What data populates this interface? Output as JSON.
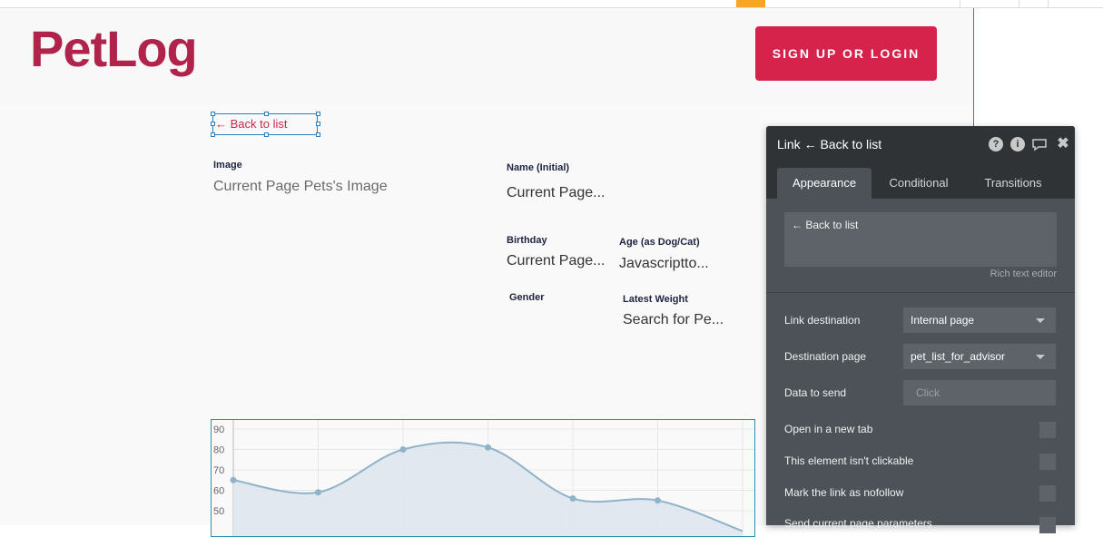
{
  "header": {
    "logo": "PetLog",
    "signup_label": "SIGN UP OR LOGIN"
  },
  "back_link": {
    "label": "← Back to list"
  },
  "fields": {
    "image": {
      "label": "Image",
      "value": "Current Page Pets's Image"
    },
    "name": {
      "label": "Name (Initial)",
      "value": "Current Page..."
    },
    "birthday": {
      "label": "Birthday",
      "value": "Current Page..."
    },
    "age": {
      "label": "Age (as Dog/Cat)",
      "value": "Javascriptto..."
    },
    "gender": {
      "label": "Gender",
      "value": ""
    },
    "weight": {
      "label": "Latest Weight",
      "value": "Search for Pe..."
    }
  },
  "chart_data": {
    "type": "line",
    "area_fill": true,
    "y_ticks": [
      "90",
      "80",
      "70",
      "60",
      "50"
    ],
    "ylim": [
      40,
      93
    ],
    "values": [
      65,
      59,
      80,
      81,
      56,
      55,
      40
    ],
    "line_color": "#8fb3c8",
    "fill_color": "#dfe6ee"
  },
  "panel": {
    "title": "Link ← Back to list",
    "icons": [
      "help-icon",
      "info-icon",
      "comment-icon",
      "close-icon"
    ],
    "tabs": [
      "Appearance",
      "Conditional",
      "Transitions"
    ],
    "active_tab": "Appearance",
    "rich_text": "← Back to list",
    "rich_text_caption": "Rich text editor",
    "link_destination": {
      "label": "Link destination",
      "value": "Internal page"
    },
    "destination_page": {
      "label": "Destination page",
      "value": "pet_list_for_advisor"
    },
    "data_to_send": {
      "label": "Data to send",
      "placeholder": "Click"
    },
    "checkboxes": [
      {
        "label": "Open in a new tab",
        "checked": false
      },
      {
        "label": "This element isn't clickable",
        "checked": false
      },
      {
        "label": "Mark the link as nofollow",
        "checked": false
      },
      {
        "label": "Send current page parameters",
        "checked": false
      }
    ]
  },
  "colors": {
    "brand": "#b0244b",
    "button": "#d5234b",
    "selection": "#2a7fc1",
    "panel_bg": "#4c5257",
    "panel_header": "#2f3336"
  }
}
